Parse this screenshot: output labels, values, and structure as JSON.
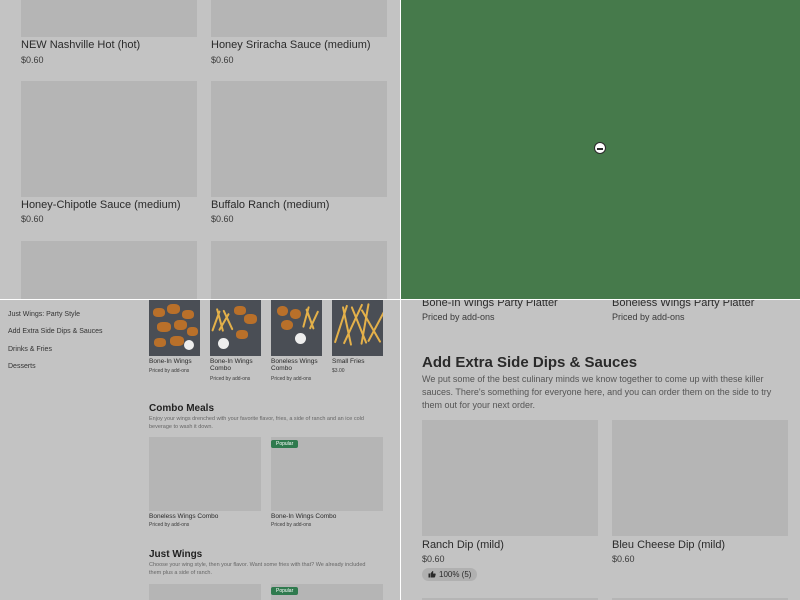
{
  "top_left": {
    "items": [
      {
        "name": "NEW Nashville Hot (hot)",
        "price": "$0.60"
      },
      {
        "name": "Honey Sriracha Sauce (medium)",
        "price": "$0.60"
      },
      {
        "name": "Honey-Chipotle Sauce (medium)",
        "price": "$0.60"
      },
      {
        "name": "Buffalo Ranch (medium)",
        "price": "$0.60"
      }
    ]
  },
  "bottom_left": {
    "nav": [
      "Just Wings: Party Style",
      "Add Extra Side Dips & Sauces",
      "Drinks & Fries",
      "Desserts"
    ],
    "top_items": [
      {
        "name": "Bone-In Wings",
        "price": "Priced by add-ons"
      },
      {
        "name": "Bone-In Wings Combo",
        "price": "Priced by add-ons"
      },
      {
        "name": "Boneless Wings Combo",
        "price": "Priced by add-ons"
      },
      {
        "name": "Small Fries",
        "price": "$3.00"
      }
    ],
    "combo": {
      "title": "Combo Meals",
      "desc": "Enjoy your wings drenched with your favorite flavor, fries, a side of ranch and an ice cold beverage to wash it down.",
      "items": [
        {
          "name": "Boneless Wings Combo",
          "price": "Priced by add-ons",
          "badge": ""
        },
        {
          "name": "Bone-In Wings Combo",
          "price": "Priced by add-ons",
          "badge": "Popular"
        }
      ]
    },
    "just_wings": {
      "title": "Just Wings",
      "desc": "Choose your wing style, then your flavor. Want some fries with that? We already included them plus a side of ranch.",
      "badge": "Popular"
    }
  },
  "bottom_right": {
    "platters": [
      {
        "name": "Bone-In Wings Party Platter",
        "price": "Priced by add-ons"
      },
      {
        "name": "Boneless Wings Party Platter",
        "price": "Priced by add-ons"
      }
    ],
    "section_title": "Add Extra Side Dips & Sauces",
    "section_desc": "We put some of the best culinary minds we know together to come up with these killer sauces. There's something for everyone here, and you can order them on the side to try them out for your next order.",
    "items": [
      {
        "name": "Ranch Dip (mild)",
        "price": "$0.60",
        "rating": "100% (5)"
      },
      {
        "name": "Bleu Cheese Dip (mild)",
        "price": "$0.60"
      }
    ]
  },
  "colors": {
    "overlay": "#c3c3c3",
    "map_green": "#467a4b",
    "badge_green": "#2f7a4e"
  },
  "icons": {
    "map_marker": "minus-circle-icon",
    "rating": "thumbs-up-icon"
  }
}
